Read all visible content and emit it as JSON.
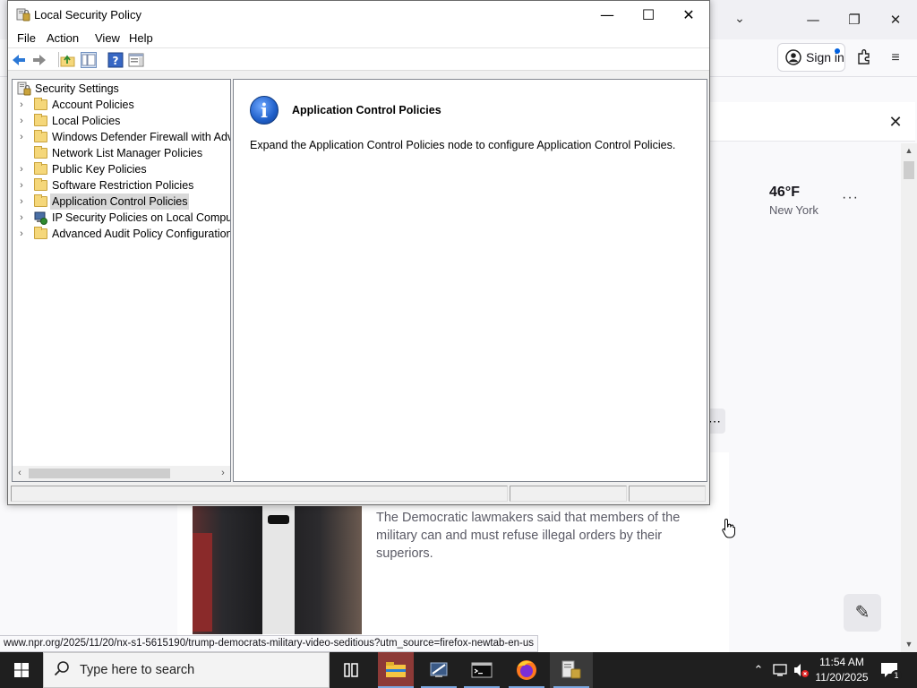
{
  "browser": {
    "signin_label": "Sign in",
    "weather": {
      "temp": "46°F",
      "city": "New York",
      "more": "···"
    },
    "article_text": "The Democratic lawmakers said that members of the military can and must refuse illegal orders by their superiors.",
    "more_dots": "⋯",
    "status_url": "www.npr.org/2025/11/20/nx-s1-5615190/trump-democrats-military-video-seditious?utm_source=firefox-newtab-en-us"
  },
  "lsp": {
    "title": "Local Security Policy",
    "menu": [
      "File",
      "Action",
      "View",
      "Help"
    ],
    "tree": [
      {
        "label": "Security Settings",
        "icon": "security-settings-icon",
        "expander": ""
      },
      {
        "label": "Account Policies",
        "icon": "folder-lock-icon",
        "expander": "›"
      },
      {
        "label": "Local Policies",
        "icon": "folder-lock-icon",
        "expander": "›"
      },
      {
        "label": "Windows Defender Firewall with Adva",
        "icon": "folder-icon",
        "expander": "›"
      },
      {
        "label": "Network List Manager Policies",
        "icon": "folder-icon",
        "expander": ""
      },
      {
        "label": "Public Key Policies",
        "icon": "folder-icon",
        "expander": "›"
      },
      {
        "label": "Software Restriction Policies",
        "icon": "folder-icon",
        "expander": "›"
      },
      {
        "label": "Application Control Policies",
        "icon": "folder-icon",
        "expander": "›",
        "selected": true
      },
      {
        "label": "IP Security Policies on Local Compute",
        "icon": "ip-security-icon",
        "expander": "›"
      },
      {
        "label": "Advanced Audit Policy Configuration",
        "icon": "folder-icon",
        "expander": "›"
      }
    ],
    "detail": {
      "title": "Application Control Policies",
      "description": "Expand the Application Control Policies node to configure Application Control Policies."
    }
  },
  "taskbar": {
    "search_placeholder": "Type here to search",
    "time": "11:54 AM",
    "date": "11/20/2025",
    "notification_count": "1"
  }
}
